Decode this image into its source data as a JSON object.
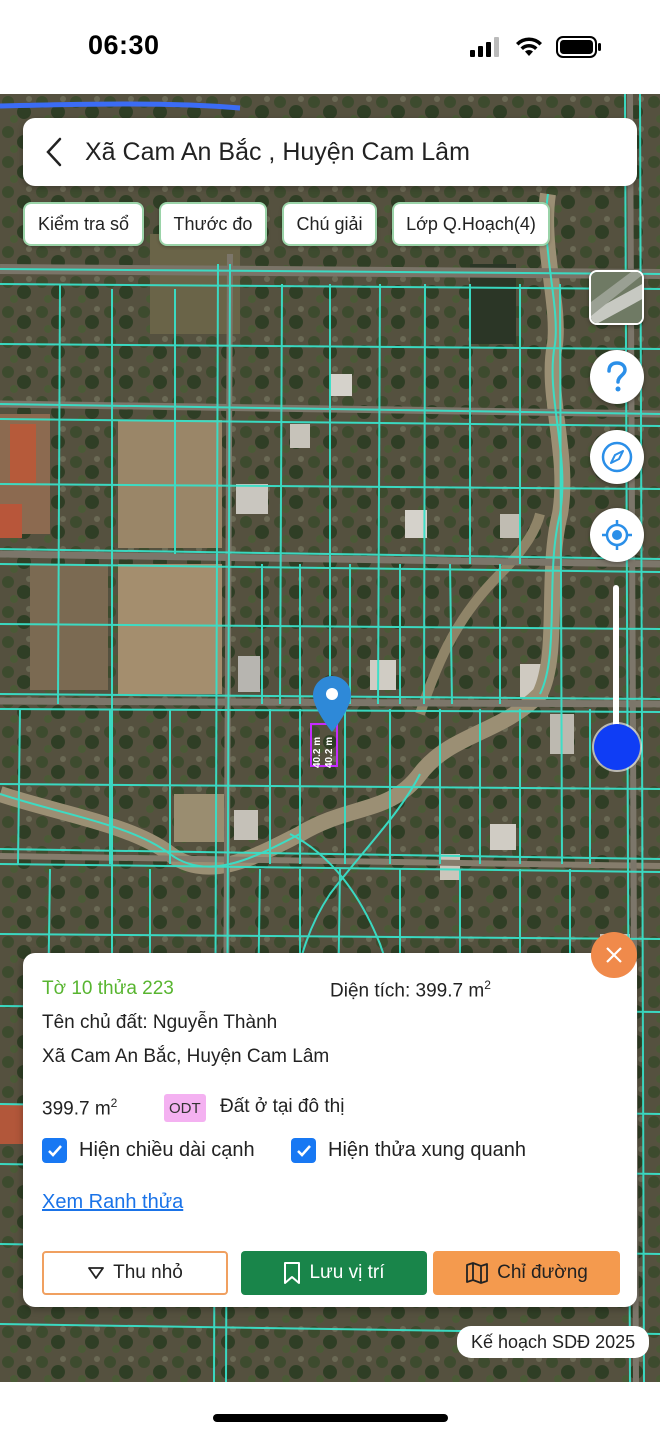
{
  "status_bar": {
    "time": "06:30"
  },
  "header": {
    "title": "Xã Cam An Bắc , Huyện Cam Lâm"
  },
  "chips": [
    {
      "label": "Kiểm tra sổ"
    },
    {
      "label": "Thước đo"
    },
    {
      "label": "Chú giải"
    },
    {
      "label": "Lớp Q.Hoạch(4)"
    }
  ],
  "map": {
    "edge_labels": [
      "40.2 m",
      "40.2 m"
    ],
    "plan_badge": "Kế hoạch SDĐ 2025"
  },
  "parcel": {
    "title": "Tờ 10 thửa 223",
    "area_label": "Diện tích: 399.7 m",
    "area_sup": "2",
    "owner": "Tên chủ đất: Nguyễn Thành",
    "address": "Xã Cam An Bắc, Huyện Cam Lâm",
    "area_value": "399.7 m",
    "area_value_sup": "2",
    "land_code": "ODT",
    "land_desc": "Đất ở tại đô thị",
    "show_edge_length_label": "Hiện chiều dài cạnh",
    "show_edge_length_checked": true,
    "show_neighbors_label": "Hiện thửa xung quanh",
    "show_neighbors_checked": true,
    "boundary_link": "Xem Ranh thửa",
    "collapse_button": "Thu nhỏ",
    "save_button": "Lưu vị trí",
    "directions_button": "Chỉ đường"
  },
  "colors": {
    "accent_green": "#58b530",
    "save_green": "#19854a",
    "orange": "#f49a4e",
    "parcel_lines": "#39e0c8",
    "link_blue": "#1a73e8"
  },
  "icons": [
    "signal-icon",
    "wifi-icon",
    "battery-icon",
    "back-chevron-icon",
    "help-icon",
    "compass-icon",
    "locate-icon",
    "close-icon",
    "chevron-down-icon",
    "bookmark-icon",
    "map-icon",
    "check-icon"
  ]
}
